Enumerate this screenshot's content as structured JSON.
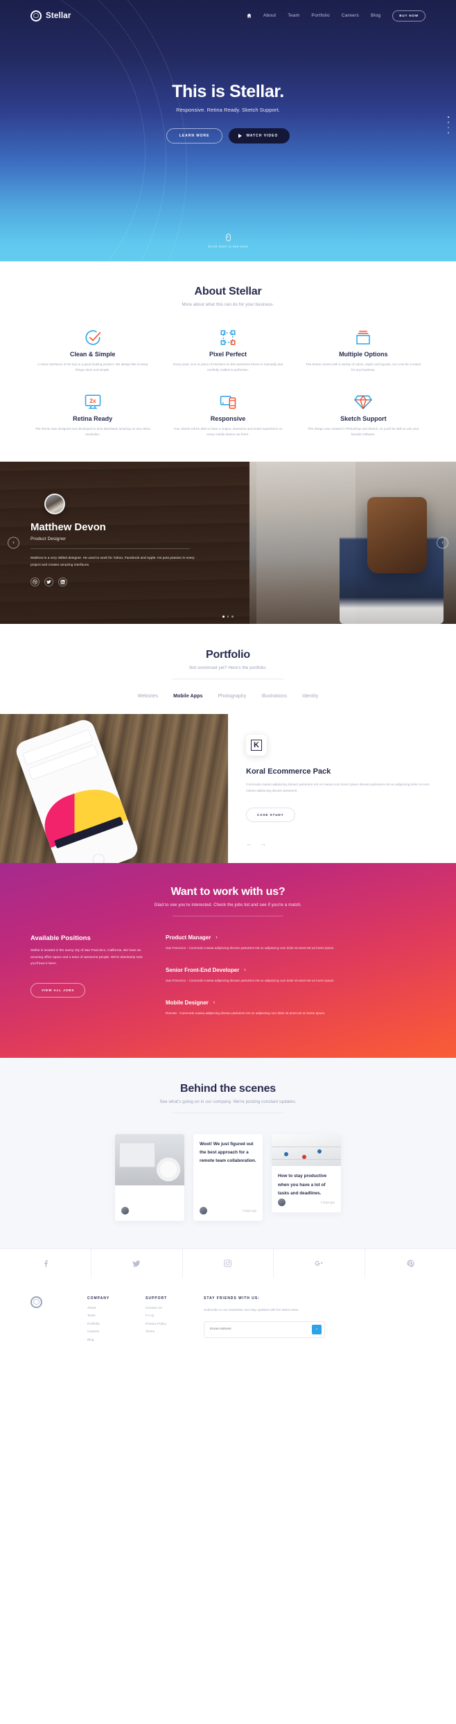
{
  "brand": {
    "name": "Stellar",
    "icon": "ring-logo-icon"
  },
  "nav": {
    "home_icon": "home-icon",
    "items": [
      {
        "label": "About"
      },
      {
        "label": "Team"
      },
      {
        "label": "Portfolio"
      },
      {
        "label": "Careers"
      },
      {
        "label": "Blog"
      }
    ],
    "cta": "BUY NOW"
  },
  "hero": {
    "title": "This is Stellar.",
    "subtitle": "Responsive. Retina Ready. Sketch Support.",
    "btn_learn": "LEARN MORE",
    "btn_watch": "WATCH VIDEO",
    "watch_icon": "play-icon",
    "scroll_icon": "mouse-icon",
    "scroll_text": "Scroll down to see more"
  },
  "about": {
    "title": "About Stellar",
    "subtitle": "More about what this can do for your business.",
    "features": [
      {
        "icon": "check-circle-icon",
        "name": "Clean & Simple",
        "desc": "A clean interfaces is the key to a good looking product. We always like to keep things clean and simple."
      },
      {
        "icon": "pixel-nodes-icon",
        "name": "Pixel Perfect",
        "desc": "Every pixel, icon or piece of interface on this awesome theme is manually and carefully crafted to perfection."
      },
      {
        "icon": "layers-box-icon",
        "name": "Multiple Options",
        "desc": "The theme comes with a variety of colors, styles and layouts, so it can be a match for any business."
      },
      {
        "icon": "monitor-2x-icon",
        "name": "Retina Ready",
        "desc": "The theme was designed and developed to look absolutely amazing on any retina resolution."
      },
      {
        "icon": "devices-icon",
        "name": "Responsive",
        "desc": "Your clients will be able to have a unique, awesome and smart experience on every mobile device out there."
      },
      {
        "icon": "diamond-icon",
        "name": "Sketch Support",
        "desc": "The design was created in Photoshop and Sketch, so you'll be able to use your favorite software."
      }
    ]
  },
  "testimonial": {
    "avatar": "person-avatar",
    "name": "Matthew Devon",
    "role": "Product Designer",
    "quote": "Matthew is a very skilled designer. He used to work for Yahoo, Facebook and Apple. He puts passion in every project and creates amazing interfaces.",
    "socials": [
      {
        "icon": "dribbble-icon",
        "label": "Dribbble"
      },
      {
        "icon": "twitter-icon",
        "label": "Twitter"
      },
      {
        "icon": "linkedin-icon",
        "label": "LinkedIn"
      }
    ],
    "prev_icon": "chevron-left-icon",
    "next_icon": "chevron-right-icon",
    "slide_count": 3,
    "active_slide": 1
  },
  "portfolio": {
    "title": "Portfolio",
    "subtitle": "Not convinced yet? Here's the portfolio.",
    "tabs": [
      {
        "label": "Websites",
        "active": false
      },
      {
        "label": "Mobile Apps",
        "active": true
      },
      {
        "label": "Photography",
        "active": false
      },
      {
        "label": "Illustrations",
        "active": false
      },
      {
        "label": "Identity",
        "active": false
      }
    ],
    "item": {
      "logo_letter": "K",
      "title": "Koral Ecommerce Pack",
      "desc": "Commodo massa adipiscing diceam parturient est un massa cum lorem ipsum diceam parturient est un adipiscing dolor es cum massa adipiscing diceam parturient.",
      "button": "CASE STUDY",
      "prev_icon": "arrow-left-icon",
      "next_icon": "arrow-right-icon"
    }
  },
  "careers": {
    "title": "Want to work with us?",
    "subtitle": "Glad to see you're interested. Check the jobs list and see if you're a match.",
    "left_title": "Available Positions",
    "left_desc": "Stellar is located in the sunny city of San Francisco, California. We have an amazing office space and a team of awesome people. We're absolutely sure you'll love it here!",
    "button": "VIEW ALL JOBS",
    "jobs": [
      {
        "title": "Product Manager",
        "chevron": "chevron-right-icon",
        "desc": "San Francisco - Commodo massa adipiscing diceam parturient est un adipiscing cum dolor sit amet est un lorem ipsum."
      },
      {
        "title": "Senior Front-End Developer",
        "chevron": "chevron-right-icon",
        "desc": "San Francisco - Commodo massa adipiscing diceam parturient est un adipiscing cum dolor sit amet est un lorem ipsum."
      },
      {
        "title": "Mobile Designer",
        "chevron": "chevron-right-icon",
        "desc": "Remote - Commodo massa adipiscing diceam parturient est un adipiscing cum dolor sit amet est un lorem ipsum."
      }
    ]
  },
  "blog": {
    "title": "Behind the scenes",
    "subtitle": "See what's going on in our company. We're posting constant updates.",
    "posts": [
      {
        "image": "keyboard-and-coffee-photo",
        "title": "",
        "date": "",
        "avatar": "author-avatar"
      },
      {
        "image": "",
        "title": "Woot! We just figured out the best approach for a remote team collaboration.",
        "date": "2 days ago",
        "avatar": "author-avatar"
      },
      {
        "image": "calendar-with-pins-photo",
        "title": "How to stay productive when you have a lot of tasks and deadlines.",
        "date": "4 days ago",
        "avatar": "author-avatar"
      }
    ]
  },
  "social_strip": [
    {
      "icon": "facebook-icon",
      "label": "Facebook"
    },
    {
      "icon": "twitter-icon",
      "label": "Twitter"
    },
    {
      "icon": "instagram-icon",
      "label": "Instagram"
    },
    {
      "icon": "google-plus-icon",
      "label": "Google Plus"
    },
    {
      "icon": "pinterest-icon",
      "label": "Pinterest"
    }
  ],
  "footer": {
    "logo_icon": "ring-logo-icon",
    "company": {
      "heading": "COMPANY",
      "links": [
        {
          "label": "About"
        },
        {
          "label": "Team"
        },
        {
          "label": "Portfolio"
        },
        {
          "label": "Careers"
        },
        {
          "label": "Blog"
        }
      ]
    },
    "support": {
      "heading": "SUPPORT",
      "links": [
        {
          "label": "Contact Us"
        },
        {
          "label": "F.A.Q."
        },
        {
          "label": "Privacy Policy"
        },
        {
          "label": "Terms"
        }
      ]
    },
    "newsletter": {
      "heading": "STAY FRIENDS WITH US:",
      "desc": "Subscribe to our newsletter and stay updated with the latest news.",
      "placeholder": "Email Address",
      "submit_icon": "arrow-right-icon"
    }
  },
  "colors": {
    "hero_top": "#1b1f4b",
    "hero_bottom": "#63cdf0",
    "ink": "#272b4d",
    "muted": "#a7acbd",
    "accent_blue": "#2aa3e8",
    "accent_orange": "#f4512c",
    "careers_start": "#a52a8e",
    "careers_end": "#f85d35"
  }
}
